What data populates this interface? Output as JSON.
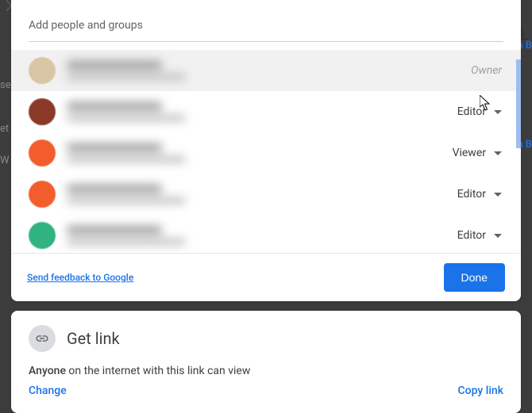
{
  "input": {
    "placeholder": "Add people and groups"
  },
  "people": [
    {
      "role": "Owner",
      "avatarColor": "#d9c6a5",
      "isOwner": true
    },
    {
      "role": "Editor",
      "avatarColor": "#8a3b28",
      "isOwner": false
    },
    {
      "role": "Viewer",
      "avatarColor": "#f35c2c",
      "isOwner": false
    },
    {
      "role": "Editor",
      "avatarColor": "#f35c2c",
      "isOwner": false
    },
    {
      "role": "Editor",
      "avatarColor": "#2fb380",
      "isOwner": false
    }
  ],
  "feedback": "Send feedback to Google",
  "doneLabel": "Done",
  "getLink": {
    "title": "Get link",
    "descBold": "Anyone",
    "descRest": " on the internet with this link can view",
    "change": "Change",
    "copy": "Copy link"
  },
  "bg": {
    "t2": "n B",
    "t3": "se",
    "t4": "et",
    "t5": "W",
    "t6": "n B"
  }
}
